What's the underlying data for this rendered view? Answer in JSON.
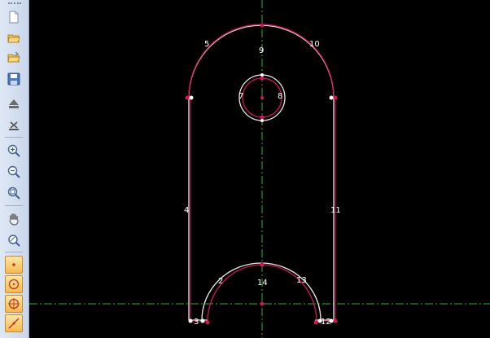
{
  "toolbar": {
    "buttons": [
      {
        "icon": "new-document-icon"
      },
      {
        "icon": "open-folder-icon"
      },
      {
        "icon": "open-recent-icon"
      },
      {
        "icon": "save-icon"
      },
      {
        "icon": "eject-icon"
      },
      {
        "icon": "close-icon"
      },
      {
        "icon": "zoom-in-icon"
      },
      {
        "icon": "zoom-out-icon"
      },
      {
        "icon": "zoom-fit-icon"
      },
      {
        "icon": "pan-hand-icon"
      },
      {
        "icon": "zoom-window-icon"
      },
      {
        "icon": "point-snap-icon",
        "active": true
      },
      {
        "icon": "center-snap-icon",
        "active": true
      },
      {
        "icon": "quadrant-snap-icon",
        "active": true
      },
      {
        "icon": "line-snap-icon",
        "active": true
      }
    ]
  },
  "drawing": {
    "labels": {
      "l2": "2",
      "l3": "3",
      "l4": "4",
      "l5": "5",
      "l7": "7",
      "l8": "8",
      "l9": "9",
      "l10": "10",
      "l11": "11",
      "l12": "12",
      "l13": "13",
      "l14": "14"
    },
    "colors": {
      "background": "#000000",
      "profile": "#e8e8e8",
      "highlight": "#d6145a",
      "centerline": "#2fae3a"
    }
  }
}
